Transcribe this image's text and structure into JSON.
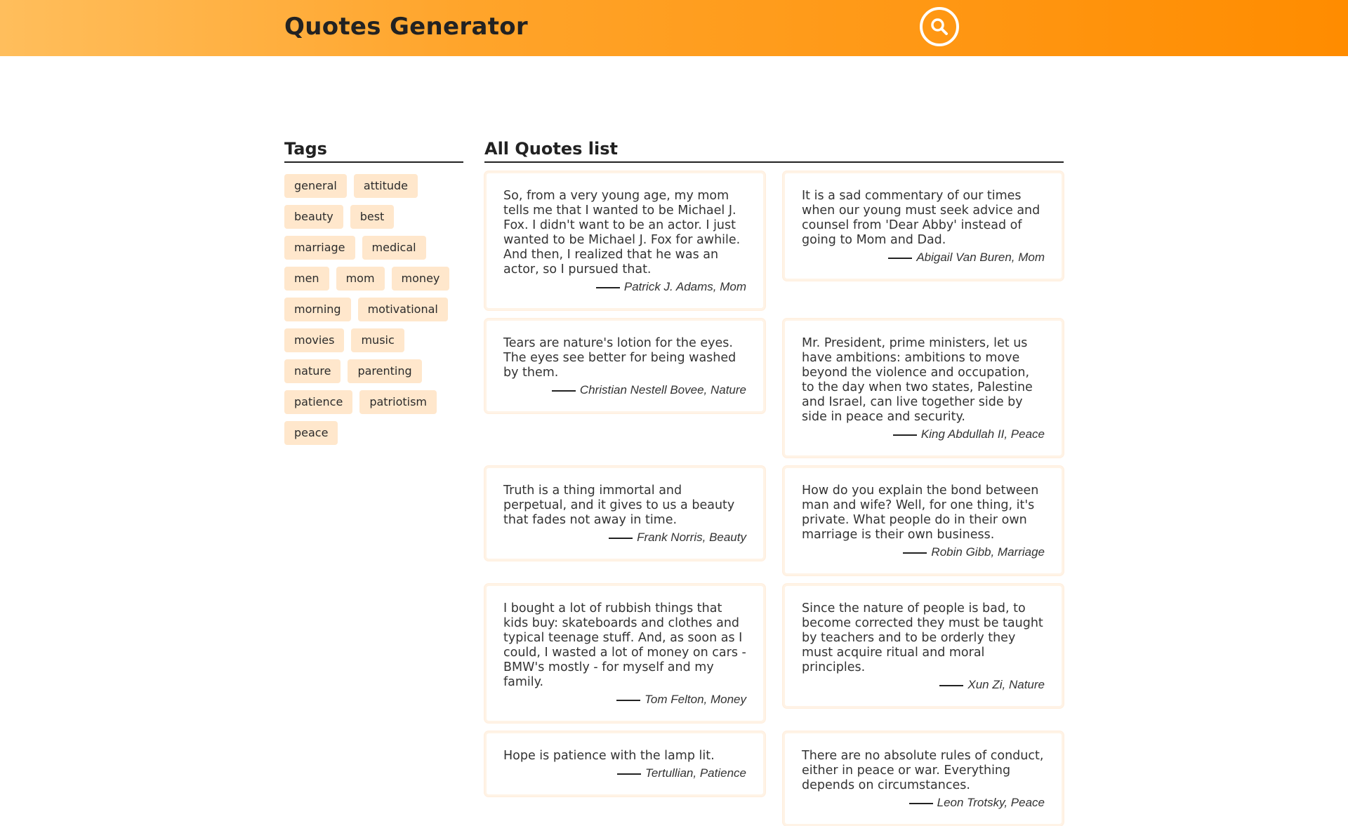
{
  "header": {
    "title": "Quotes Generator",
    "search_icon": "search-icon"
  },
  "sidebar": {
    "title": "Tags",
    "tags": [
      "general",
      "attitude",
      "beauty",
      "best",
      "marriage",
      "medical",
      "men",
      "mom",
      "money",
      "morning",
      "motivational",
      "movies",
      "music",
      "nature",
      "parenting",
      "patience",
      "patriotism",
      "peace"
    ]
  },
  "main": {
    "title": "All Quotes list",
    "quotes": [
      {
        "text": "So, from a very young age, my mom tells me that I wanted to be Michael J. Fox. I didn't want to be an actor. I just wanted to be Michael J. Fox for awhile. And then, I realized that he was an actor, so I pursued that.",
        "author": "Patrick J. Adams, Mom"
      },
      {
        "text": "It is a sad commentary of our times when our young must seek advice and counsel from 'Dear Abby' instead of going to Mom and Dad.",
        "author": "Abigail Van Buren, Mom"
      },
      {
        "text": "Tears are nature's lotion for the eyes. The eyes see better for being washed by them.",
        "author": "Christian Nestell Bovee, Nature"
      },
      {
        "text": "Mr. President, prime ministers, let us have ambitions: ambitions to move beyond the violence and occupation, to the day when two states, Palestine and Israel, can live together side by side in peace and security.",
        "author": "King Abdullah II, Peace"
      },
      {
        "text": "Truth is a thing immortal and perpetual, and it gives to us a beauty that fades not away in time.",
        "author": "Frank Norris, Beauty"
      },
      {
        "text": "How do you explain the bond between man and wife? Well, for one thing, it's private. What people do in their own marriage is their own business.",
        "author": "Robin Gibb, Marriage"
      },
      {
        "text": "I bought a lot of rubbish things that kids buy: skateboards and clothes and typical teenage stuff. And, as soon as I could, I wasted a lot of money on cars - BMW's mostly - for myself and my family.",
        "author": "Tom Felton, Money"
      },
      {
        "text": "Since the nature of people is bad, to become corrected they must be taught by teachers and to be orderly they must acquire ritual and moral principles.",
        "author": "Xun Zi, Nature"
      },
      {
        "text": "Hope is patience with the lamp lit.",
        "author": "Tertullian, Patience"
      },
      {
        "text": "There are no absolute rules of conduct, either in peace or war. Everything depends on circumstances.",
        "author": "Leon Trotsky, Peace"
      }
    ]
  }
}
